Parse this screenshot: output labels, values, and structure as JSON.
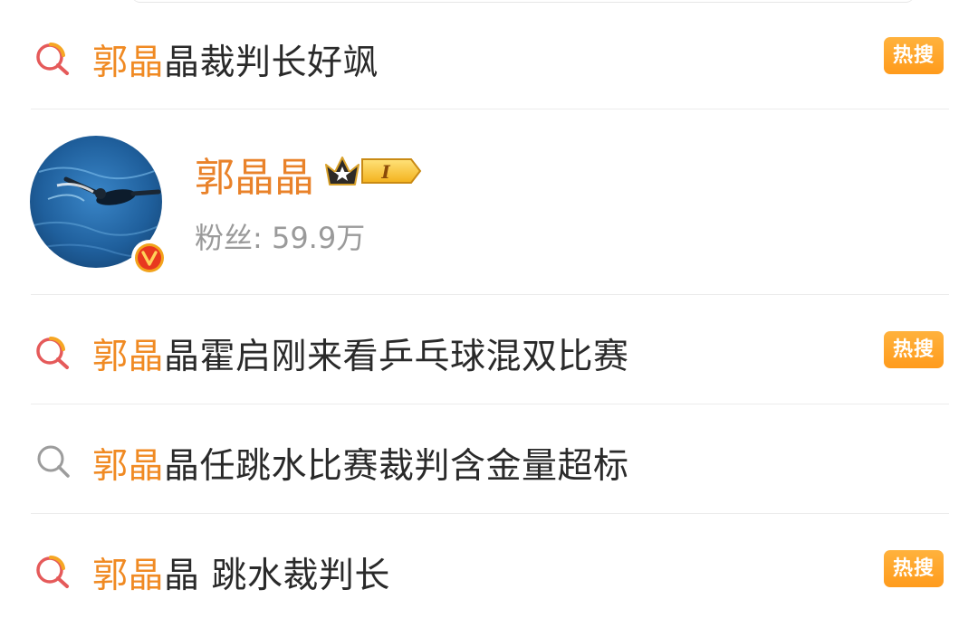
{
  "suggestions": [
    {
      "highlight": "郭晶",
      "rest": "晶裁判长好飒",
      "badge": "热搜",
      "icon": "hot-search-icon"
    },
    {
      "highlight": "郭晶",
      "rest": "晶霍启刚来看乒乓球混双比赛",
      "badge": "热搜",
      "icon": "hot-search-icon"
    },
    {
      "highlight": "郭晶",
      "rest": "晶任跳水比赛裁判含金量超标",
      "badge": "",
      "icon": "search-icon"
    },
    {
      "highlight": "郭晶",
      "rest": "晶 跳水裁判长",
      "badge": "热搜",
      "icon": "hot-search-icon"
    }
  ],
  "user": {
    "name": "郭晶晶",
    "fans_label": "粉丝: 59.9万",
    "level_badge": "I",
    "verified_mark": "V"
  },
  "colors": {
    "highlight": "#f08a23",
    "name": "#e9822a",
    "badge": "#ff9f1f",
    "verified": "#e8381f"
  }
}
